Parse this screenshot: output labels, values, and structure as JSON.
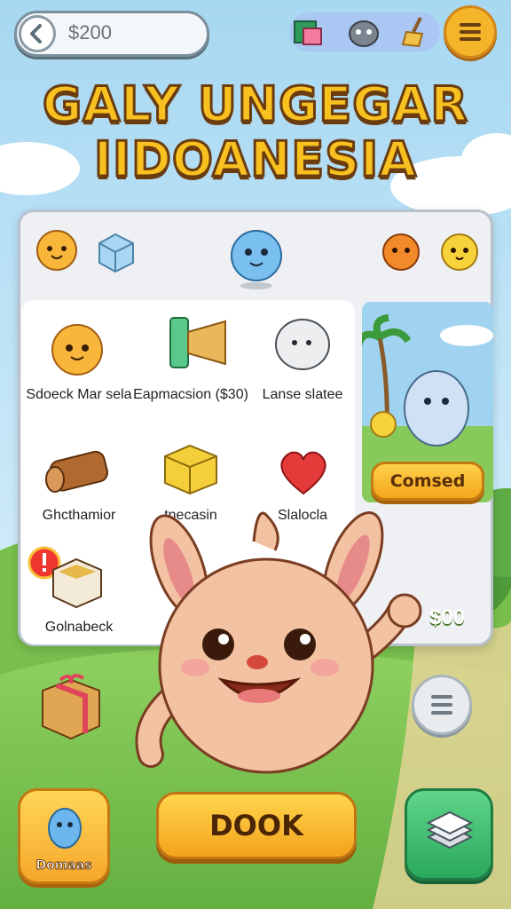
{
  "header": {
    "balance": "$200",
    "menu_icon": "hamburger-icon"
  },
  "title": {
    "line1": "GALY UNGEGAR",
    "line2": "IIDOANESIA"
  },
  "shop": {
    "items": [
      {
        "label": "Sdoeck Mar sela",
        "icon": "hamster-icon"
      },
      {
        "label": "Eapmacsion ($30)",
        "icon": "megaphone-icon"
      },
      {
        "label": "Lanse slatee",
        "icon": "ghost-icon"
      },
      {
        "label": "Ghcthamior",
        "icon": "log-icon"
      },
      {
        "label": "tnecasin",
        "icon": "gold-block-icon"
      },
      {
        "label": "Slalocla",
        "icon": "heart-icon"
      },
      {
        "label": "Golnabeck",
        "icon": "crate-icon"
      }
    ],
    "featured_button": "Comsed",
    "price": "$00"
  },
  "bottom": {
    "left_button_label": "Domaas",
    "main_button_label": "DOOK"
  },
  "colors": {
    "accent": "#f5b52a",
    "title_fill": "#f9c11f",
    "title_outline": "#6a3c10",
    "green_button": "#2aa85c",
    "sky": "#bfe4f6",
    "grass": "#7cc653"
  }
}
